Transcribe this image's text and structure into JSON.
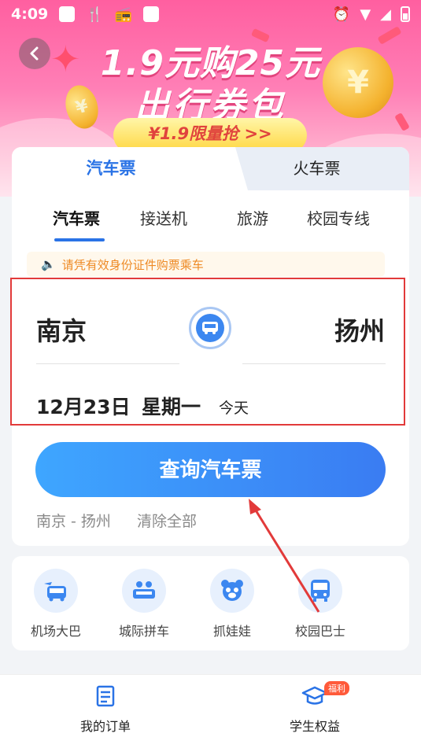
{
  "status_bar": {
    "time": "4:09"
  },
  "banner": {
    "headline_line1": "1.9元购25元",
    "headline_line2": "出行券包",
    "promo_button": "¥1.9限量抢 >>",
    "coin_symbol": "¥"
  },
  "main_tabs": [
    {
      "label": "汽车票"
    },
    {
      "label": "火车票"
    }
  ],
  "sub_tabs": [
    {
      "label": "汽车票"
    },
    {
      "label": "接送机"
    },
    {
      "label": "旅游"
    },
    {
      "label": "校园专线"
    }
  ],
  "notice": "请凭有效身份证件购票乘车",
  "route": {
    "from": "南京",
    "to": "扬州",
    "date": "12月23日",
    "weekday": "星期一",
    "relative_day": "今天"
  },
  "search_button": "查询汽车票",
  "history": {
    "item": "南京 - 扬州",
    "clear_label": "清除全部"
  },
  "services": [
    {
      "label": "机场大巴"
    },
    {
      "label": "城际拼车"
    },
    {
      "label": "抓娃娃"
    },
    {
      "label": "校园巴士"
    }
  ],
  "bottom_nav": {
    "orders": "我的订单",
    "student": "学生权益",
    "student_badge": "福利"
  },
  "colors": {
    "accent": "#2a73e6",
    "banner": "#ff5fa0",
    "highlight": "#e23a3a",
    "notice_text": "#ee8a25"
  }
}
